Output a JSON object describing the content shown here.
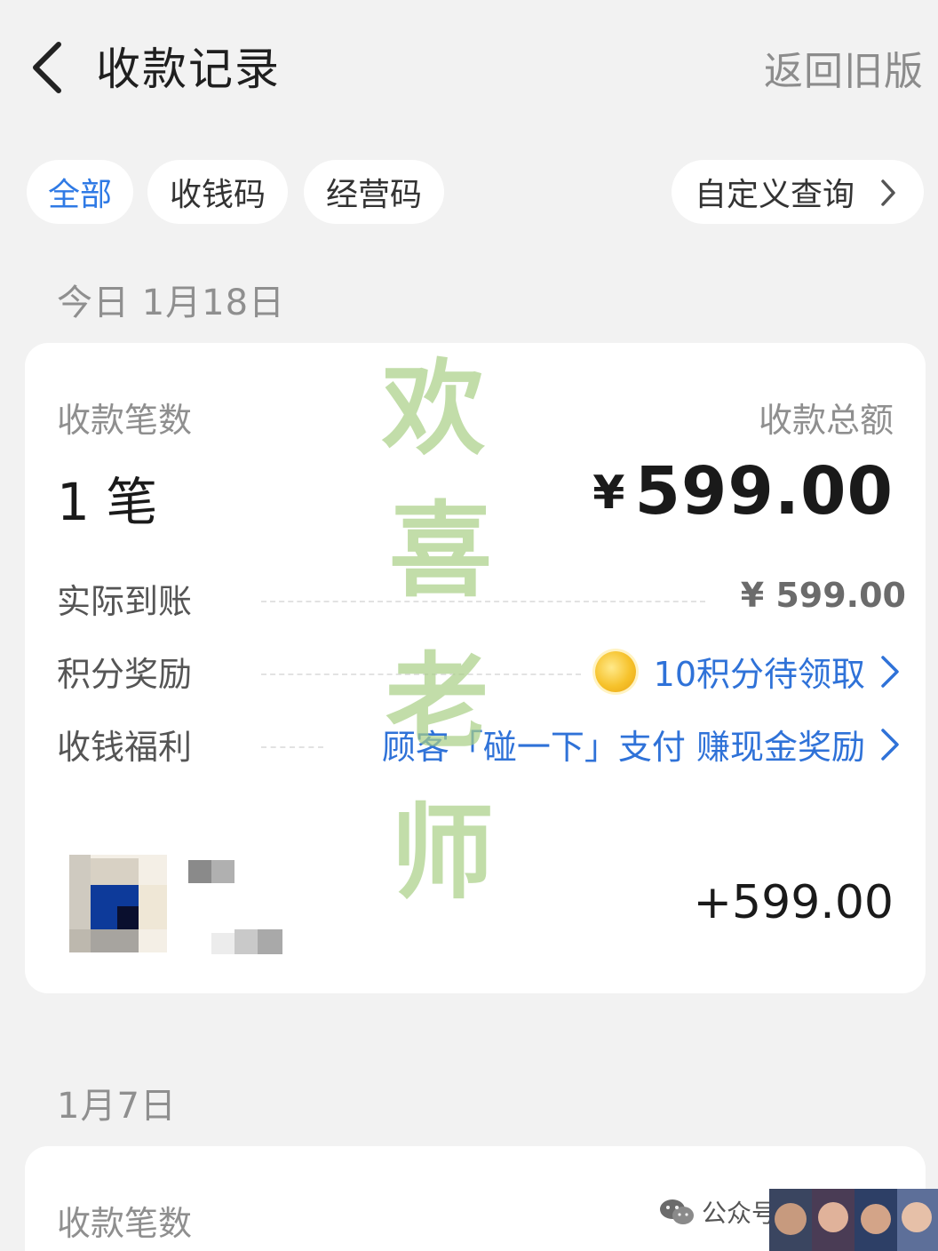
{
  "header": {
    "title": "收款记录",
    "old_version": "返回旧版"
  },
  "filters": {
    "all": "全部",
    "qr_code": "收钱码",
    "business_code": "经营码",
    "custom_query": "自定义查询"
  },
  "today": {
    "date": "今日 1月18日",
    "count_label": "收款笔数",
    "total_label": "收款总额",
    "count_value": "1 笔",
    "currency": "¥",
    "total_value": "599.00",
    "rows": [
      {
        "label": "实际到账",
        "value": "¥ 599.00"
      },
      {
        "label": "积分奖励",
        "value": "10积分待领取"
      },
      {
        "label": "收钱福利",
        "value": "顾客「碰一下」支付 赚现金奖励"
      }
    ],
    "transaction": {
      "amount": "+599.00"
    }
  },
  "earlier": {
    "date": "1月7日",
    "count_label": "收款笔数"
  },
  "watermark": [
    "欢",
    "喜",
    "老",
    "师"
  ],
  "footer": {
    "tag": "公众号"
  },
  "colors": {
    "accent": "#2f72d8",
    "watermark": "#a9cf86",
    "background": "#f2f2f2"
  }
}
